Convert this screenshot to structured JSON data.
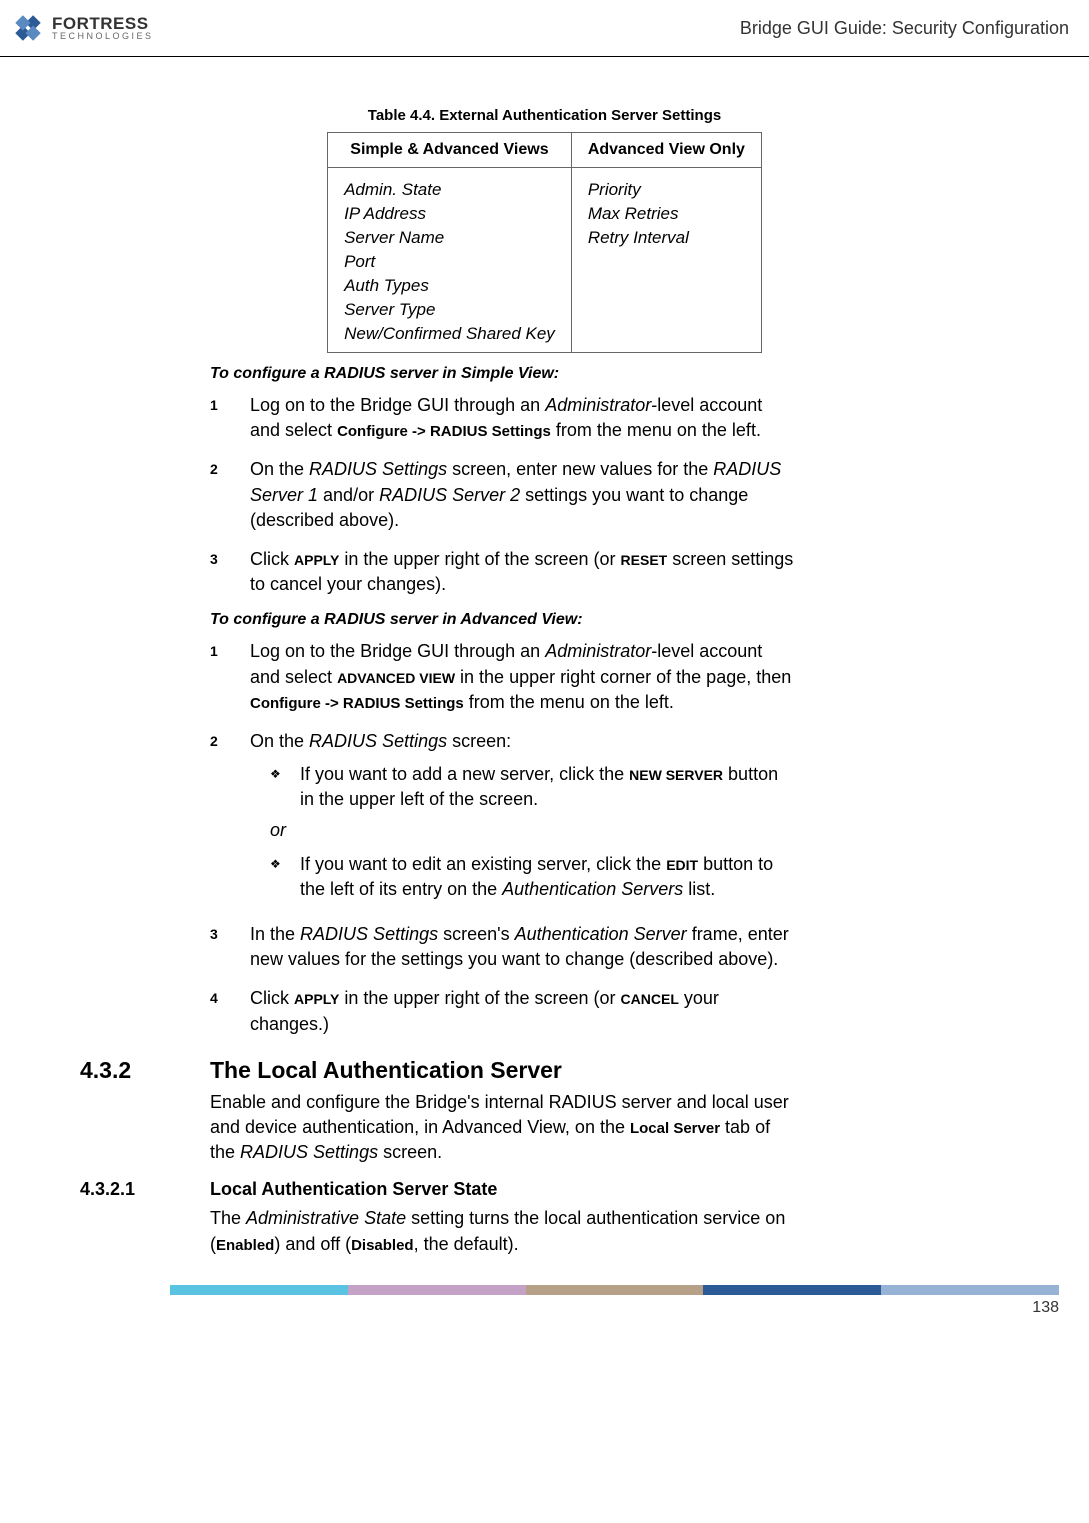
{
  "header": {
    "logo_main": "FORTRESS",
    "logo_sub": "TECHNOLOGIES",
    "title": "Bridge GUI Guide: Security Configuration"
  },
  "table": {
    "caption": "Table 4.4. External Authentication Server Settings",
    "header_left": "Simple & Advanced Views",
    "header_right": "Advanced View Only",
    "left_items": [
      "Admin. State",
      "IP Address",
      "Server Name",
      "Port",
      "Auth Types",
      "Server Type",
      "New/Confirmed Shared Key"
    ],
    "right_items": [
      "Priority",
      "Max Retries",
      "Retry Interval"
    ]
  },
  "simple_view": {
    "heading": "To configure a RADIUS server in Simple View:",
    "step1_p1": "Log on to the Bridge GUI through an ",
    "step1_admin": "Administrator",
    "step1_p2": "-level account and select ",
    "step1_config": "Configure -> RADIUS Settings",
    "step1_p3": " from the menu on the left.",
    "step2_p1": "On the ",
    "step2_radius": "RADIUS Settings",
    "step2_p2": " screen, enter new values for the ",
    "step2_rs1": "RADIUS Server 1",
    "step2_p3": " and/or ",
    "step2_rs2": "RADIUS Server 2",
    "step2_p4": " settings you want to change (described above).",
    "step3_p1": "Click ",
    "step3_apply": "APPLY",
    "step3_p2": " in the upper right of the screen (or ",
    "step3_reset": "RESET",
    "step3_p3": " screen settings to cancel your changes)."
  },
  "advanced_view": {
    "heading": "To configure a RADIUS server in Advanced View:",
    "step1_p1": "Log on to the Bridge GUI through an ",
    "step1_admin": "Administrator",
    "step1_p2": "-level account and select ",
    "step1_adv": "ADVANCED VIEW",
    "step1_p3": " in the upper right corner of the page, then ",
    "step1_config": "Configure -> RADIUS Settings",
    "step1_p4": " from the menu on the left.",
    "step2_p1": "On the ",
    "step2_radius": "RADIUS Settings",
    "step2_p2": " screen:",
    "bullet1_p1": "If you want to add a new server, click the ",
    "bullet1_new": "NEW SERVER",
    "bullet1_p2": " button in the upper left of the screen.",
    "or_text": "or",
    "bullet2_p1": "If you want to edit an existing server, click the ",
    "bullet2_edit": "EDIT",
    "bullet2_p2": " button to the left of its entry on the ",
    "bullet2_auth": "Authentication Servers",
    "bullet2_p3": " list.",
    "step3_p1": "In the ",
    "step3_radius": "RADIUS Settings",
    "step3_p2": " screen's ",
    "step3_auth": "Authentication Server",
    "step3_p3": " frame, enter new values for the settings you want to change (described above).",
    "step4_p1": "Click ",
    "step4_apply": "APPLY",
    "step4_p2": " in the upper right of the screen (or ",
    "step4_cancel": "CANCEL",
    "step4_p3": " your changes.)"
  },
  "section_432": {
    "number": "4.3.2",
    "heading": "The Local Authentication Server",
    "p1": "Enable and configure the Bridge's internal RADIUS server and local user and device authentication, in Advanced View, on the ",
    "local_server": "Local Server",
    "p2": " tab of the ",
    "radius": "RADIUS Settings",
    "p3": " screen."
  },
  "section_4321": {
    "number": "4.3.2.1",
    "heading": "Local Authentication Server State",
    "p1": "The ",
    "admin_state": "Administrative State",
    "p2": " setting turns the local authentication service on (",
    "enabled": "Enabled",
    "p3": ") and off (",
    "disabled": "Disabled",
    "p4": ", the default)."
  },
  "footer": {
    "page_number": "138",
    "colors": [
      "#59c3e1",
      "#c4a2c6",
      "#b6a088",
      "#2b5a96",
      "#96b2d5"
    ]
  }
}
